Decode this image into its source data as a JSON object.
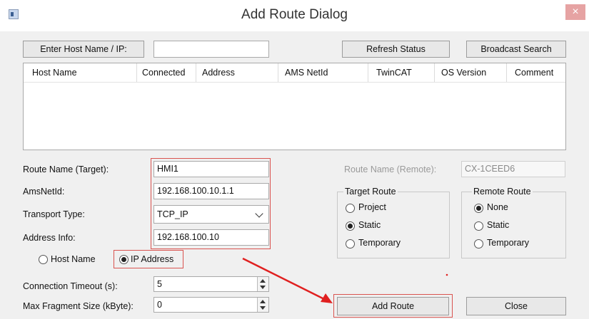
{
  "window": {
    "title": "Add Route Dialog",
    "close_glyph": "×"
  },
  "toolbar": {
    "enter_host_label": "Enter Host Name / IP:",
    "host_input_value": "",
    "refresh_label": "Refresh Status",
    "broadcast_label": "Broadcast Search"
  },
  "table": {
    "columns": [
      "Host Name",
      "Connected",
      "Address",
      "AMS NetId",
      "TwinCAT",
      "OS Version",
      "Comment"
    ]
  },
  "form": {
    "route_name_label": "Route Name (Target):",
    "route_name_value": "HMI1",
    "ams_label": "AmsNetId:",
    "ams_value": "192.168.100.10.1.1",
    "transport_label": "Transport Type:",
    "transport_value": "TCP_IP",
    "address_label": "Address Info:",
    "address_value": "192.168.100.10",
    "host_name_radio": "Host Name",
    "ip_address_radio": "IP Address",
    "timeout_label": "Connection Timeout (s):",
    "timeout_value": "5",
    "fragment_label": "Max Fragment Size (kByte):",
    "fragment_value": "0"
  },
  "remote": {
    "route_name_label": "Route Name (Remote):",
    "route_name_value": "CX-1CEED6"
  },
  "target_route": {
    "title": "Target Route",
    "options": [
      "Project",
      "Static",
      "Temporary"
    ],
    "selected": "Static"
  },
  "remote_route": {
    "title": "Remote Route",
    "options": [
      "None",
      "Static",
      "Temporary"
    ],
    "selected": "None"
  },
  "buttons": {
    "add_route": "Add Route",
    "close": "Close"
  },
  "colors": {
    "highlight": "#d9534f",
    "arrow": "#e02020"
  }
}
